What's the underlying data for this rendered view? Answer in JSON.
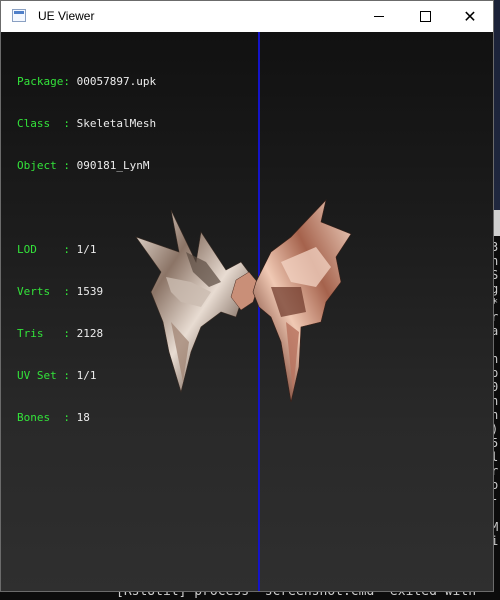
{
  "window": {
    "title": "UE Viewer",
    "controls": [
      "minimize",
      "maximize",
      "close"
    ]
  },
  "info": {
    "package": {
      "label": "Package:",
      "value": "00057897.upk"
    },
    "class": {
      "label": "Class  :",
      "value": "SkeletalMesh"
    },
    "object": {
      "label": "Object :",
      "value": "090181_LynM"
    },
    "lod": {
      "label": "LOD    :",
      "value": "1/1"
    },
    "verts": {
      "label": "Verts  :",
      "value": "1539"
    },
    "tris": {
      "label": "Tris   :",
      "value": "2128"
    },
    "uvset": {
      "label": "UV Set :",
      "value": "1/1"
    },
    "bones": {
      "label": "Bones  :",
      "value": "18"
    }
  },
  "colors": {
    "label_green": "#33e33a",
    "axis_blue": "#1414c8"
  },
  "console": {
    "side_chars": [
      "3",
      "n",
      "S",
      "g",
      "*",
      "r",
      "a",
      "",
      "n",
      "p",
      "0",
      "n",
      "n",
      ")",
      "5",
      "l",
      "r",
      "o",
      "-",
      "",
      "M",
      "i"
    ],
    "bottom_line": "[RstUtil] process \"screenshot.cmd\" exited with"
  },
  "desktop": {
    "edge_text": "M"
  }
}
